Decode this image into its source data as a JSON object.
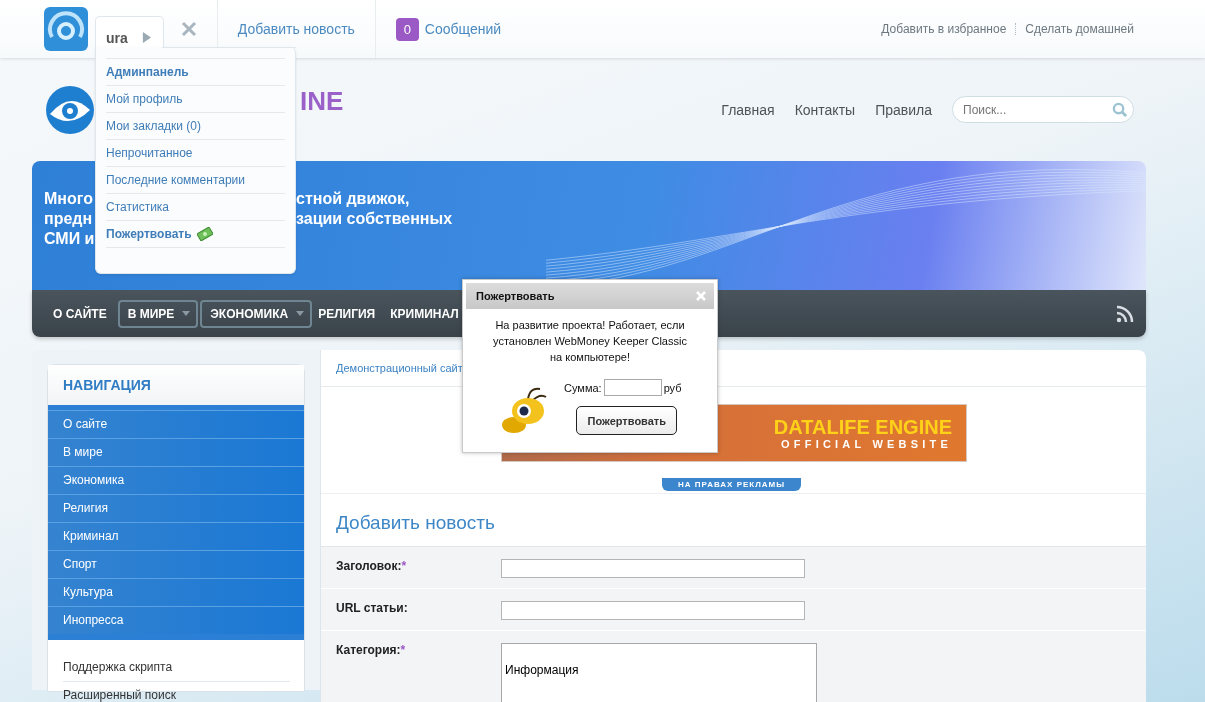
{
  "top_bar": {
    "user_tab": {
      "name": "ura",
      "expanded": true
    },
    "add_news": "Добавить новость",
    "messages": {
      "count": "0",
      "label": "Сообщений"
    },
    "right_links": [
      "Добавить в избранное",
      "Сделать домашней"
    ]
  },
  "user_menu": {
    "items": [
      {
        "label": "Админпанель",
        "kind": "bold"
      },
      {
        "label": "Мой профиль",
        "kind": "plain"
      },
      {
        "label": "Мои закладки (0)",
        "kind": "plain"
      },
      {
        "label": "Непрочитанное",
        "kind": "plain"
      },
      {
        "label": "Последние комментарии",
        "kind": "plain"
      },
      {
        "label": "Статистика",
        "kind": "plain"
      },
      {
        "label": "Пожертвовать",
        "kind": "donate"
      }
    ]
  },
  "header": {
    "logo_text": "INE",
    "links": [
      "Главная",
      "Контакты",
      "Правила"
    ],
    "search": {
      "placeholder": "Поиск..."
    }
  },
  "banner": {
    "lines": [
      {
        "left": "Много",
        "right": "стной движок,"
      },
      {
        "left": "предн",
        "right": "зации собственных"
      },
      {
        "left": "СМИ и"
      }
    ]
  },
  "nav_bar": {
    "items": [
      {
        "label": "О САЙТЕ",
        "kind": "link"
      },
      {
        "label": "В МИРЕ",
        "kind": "dropdown"
      },
      {
        "label": "ЭКОНОМИКА",
        "kind": "dropdown"
      },
      {
        "label": "РЕЛИГИЯ",
        "kind": "link"
      },
      {
        "label": "КРИМИНАЛ",
        "kind": "link"
      }
    ]
  },
  "sidebar": {
    "title": "НАВИГАЦИЯ",
    "items": [
      "О сайте",
      "В мире",
      "Экономика",
      "Религия",
      "Криминал",
      "Спорт",
      "Культура",
      "Инопресса"
    ],
    "links": [
      "Поддержка скрипта",
      "Расширенный поиск"
    ]
  },
  "content": {
    "breadcrumb": "Демонстрационный сайт",
    "ad": {
      "title": "DATALIFE ENGINE",
      "subtitle": "OFFICIAL WEBSITE",
      "label": "НА ПРАВАХ РЕКЛАМЫ"
    },
    "heading": "Добавить новость",
    "form": [
      {
        "label": "Заголовок:",
        "required_mark": "*",
        "kind": "text"
      },
      {
        "label": "URL статьи:",
        "kind": "text"
      },
      {
        "label": "Категория:",
        "required_mark": "*",
        "kind": "select",
        "options": [
          "Информация"
        ]
      }
    ]
  },
  "donate_dialog": {
    "title": "Пожертвовать",
    "message": "На развитие проекта! Работает, если установлен WebMoney Keeper Classic на компьютере!",
    "amount_label": "Сумма:",
    "currency": "руб",
    "button": "Пожертвовать"
  }
}
